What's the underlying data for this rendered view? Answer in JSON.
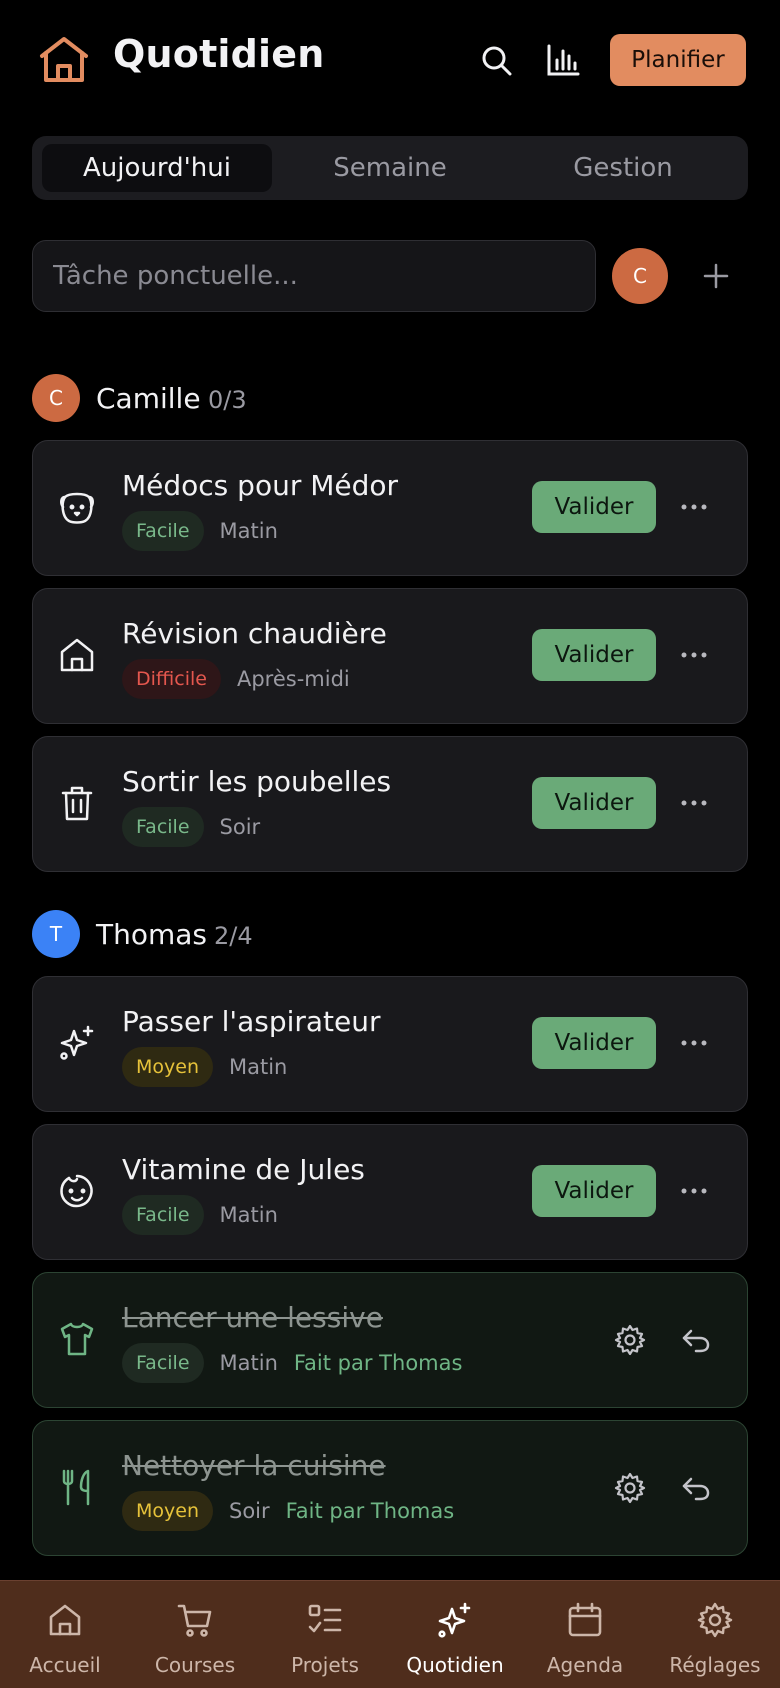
{
  "header": {
    "title": "Quotidien",
    "plan_label": "Planifier",
    "icons": [
      "home-icon",
      "search-icon",
      "stats-icon"
    ],
    "accent_color": "#e28c60"
  },
  "tabs": [
    {
      "label": "Aujourd'hui",
      "active": true
    },
    {
      "label": "Semaine",
      "active": false
    },
    {
      "label": "Gestion",
      "active": false
    }
  ],
  "quick_add": {
    "placeholder": "Tâche ponctuelle...",
    "value": "",
    "assignee_initial": "C"
  },
  "sections": [
    {
      "initial": "C",
      "name": "Camille",
      "count": "0/3",
      "color": "#cc6a42",
      "tasks": [
        {
          "title": "Médocs pour Médor",
          "icon": "dog-icon",
          "difficulty": "Facile",
          "slot": "Matin",
          "action": "Valider",
          "done": false
        },
        {
          "title": "Révision chaudière",
          "icon": "house-icon",
          "difficulty": "Difficile",
          "slot": "Après-midi",
          "action": "Valider",
          "done": false
        },
        {
          "title": "Sortir les poubelles",
          "icon": "trash-icon",
          "difficulty": "Facile",
          "slot": "Soir",
          "action": "Valider",
          "done": false
        }
      ]
    },
    {
      "initial": "T",
      "name": "Thomas",
      "count": "2/4",
      "color": "#3b82f6",
      "tasks": [
        {
          "title": "Passer l'aspirateur",
          "icon": "sparkles-icon",
          "difficulty": "Moyen",
          "slot": "Matin",
          "action": "Valider",
          "done": false
        },
        {
          "title": "Vitamine de Jules",
          "icon": "baby-icon",
          "difficulty": "Facile",
          "slot": "Matin",
          "action": "Valider",
          "done": false
        },
        {
          "title": "Lancer une lessive",
          "icon": "shirt-icon",
          "difficulty": "Facile",
          "slot": "Matin",
          "done_by": "Fait par Thomas",
          "done": true
        },
        {
          "title": "Nettoyer la cuisine",
          "icon": "utensils-icon",
          "difficulty": "Moyen",
          "slot": "Soir",
          "done_by": "Fait par Thomas",
          "done": true
        }
      ]
    }
  ],
  "nav": [
    {
      "label": "Accueil",
      "icon": "home-icon",
      "active": false
    },
    {
      "label": "Courses",
      "icon": "cart-icon",
      "active": false
    },
    {
      "label": "Projets",
      "icon": "checklist-icon",
      "active": false
    },
    {
      "label": "Quotidien",
      "icon": "sparkles-icon",
      "active": true
    },
    {
      "label": "Agenda",
      "icon": "calendar-icon",
      "active": false
    },
    {
      "label": "Réglages",
      "icon": "gear-icon",
      "active": false
    }
  ],
  "colors": {
    "easy": "#79b88a",
    "hard": "#e4574e",
    "medium": "#e6c23a",
    "validate": "#6aaa78",
    "nav_background": "#4f2d1c"
  }
}
